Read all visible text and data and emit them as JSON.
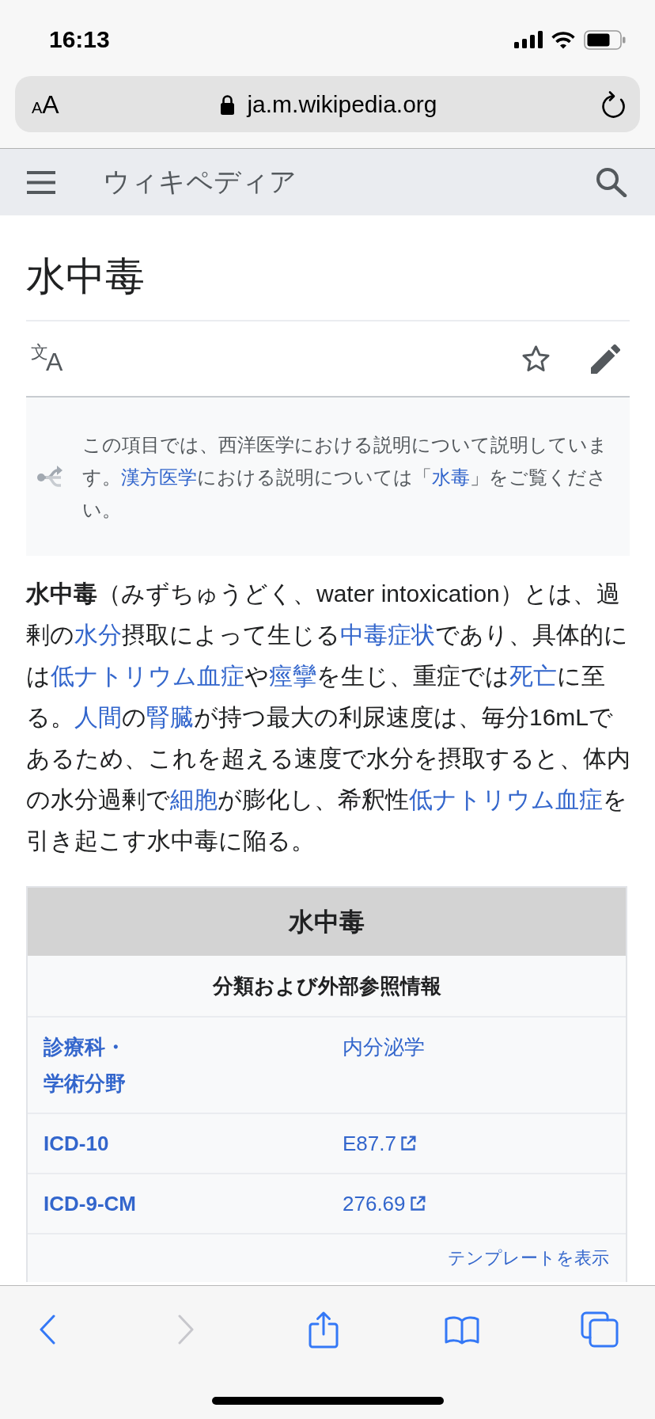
{
  "status_bar": {
    "time": "16:13"
  },
  "address_bar": {
    "text_size_button": {
      "small_letter": "A",
      "large_letter": "A"
    },
    "secure": true,
    "url": "ja.m.wikipedia.org"
  },
  "site_header": {
    "logo": "ウィキペディア"
  },
  "article": {
    "title": "水中毒",
    "actions": [
      {
        "kind": "language",
        "upper_glyph": "文",
        "lower_glyph": "A"
      },
      {
        "kind": "watch",
        "watched": false
      },
      {
        "kind": "edit"
      }
    ],
    "hatnote": {
      "segments": [
        {
          "kind": "text",
          "text": "この項目では、西洋医学における説明について説明しています。"
        },
        {
          "kind": "link",
          "text": "漢方医学"
        },
        {
          "kind": "text",
          "text": "における説明については「"
        },
        {
          "kind": "link",
          "text": "水毒"
        },
        {
          "kind": "text",
          "text": "」をご覧ください。"
        }
      ]
    },
    "lead": {
      "segments": [
        {
          "kind": "text",
          "text": "**水中毒**（みずちゅうどく、water intoxication）とは、過剰の"
        },
        {
          "kind": "link",
          "text": "水分"
        },
        {
          "kind": "text",
          "text": "摂取によって生じる"
        },
        {
          "kind": "link",
          "text": "中毒症状"
        },
        {
          "kind": "text",
          "text": "であり、具体的には"
        },
        {
          "kind": "link",
          "text": "低ナトリウム血症"
        },
        {
          "kind": "text",
          "text": "や"
        },
        {
          "kind": "link",
          "text": "痙攣"
        },
        {
          "kind": "text",
          "text": "を生じ、重症では"
        },
        {
          "kind": "link",
          "text": "死亡"
        },
        {
          "kind": "text",
          "text": "に至る。"
        },
        {
          "kind": "link",
          "text": "人間"
        },
        {
          "kind": "text",
          "text": "の"
        },
        {
          "kind": "link",
          "text": "腎臓"
        },
        {
          "kind": "text",
          "text": "が持つ最大の利尿速度は、毎分16mLであるため、これを超える速度で水分を摂取すると、体内の水分過剰で"
        },
        {
          "kind": "link",
          "text": "細胞"
        },
        {
          "kind": "text",
          "text": "が膨化し、希釈性"
        },
        {
          "kind": "link",
          "text": "低ナトリウム血症"
        },
        {
          "kind": "text",
          "text": "を引き起こす水中毒に陥る。"
        }
      ]
    },
    "infobox": {
      "title": "水中毒",
      "subtitle": "分類および外部参照情報",
      "rows": [
        {
          "label": "診療科・学術分野",
          "value": "内分泌学",
          "external": false
        },
        {
          "label": "ICD-10",
          "value": "E87.7",
          "external": true
        },
        {
          "label": "ICD-9-CM",
          "value": "276.69",
          "external": true
        }
      ],
      "footer_link": "テンプレートを表示"
    }
  },
  "toolbar": [
    {
      "kind": "back",
      "disabled": false
    },
    {
      "kind": "forward",
      "disabled": true
    },
    {
      "kind": "share",
      "disabled": false
    },
    {
      "kind": "bookmarks",
      "disabled": false
    },
    {
      "kind": "tabs",
      "disabled": false
    }
  ]
}
